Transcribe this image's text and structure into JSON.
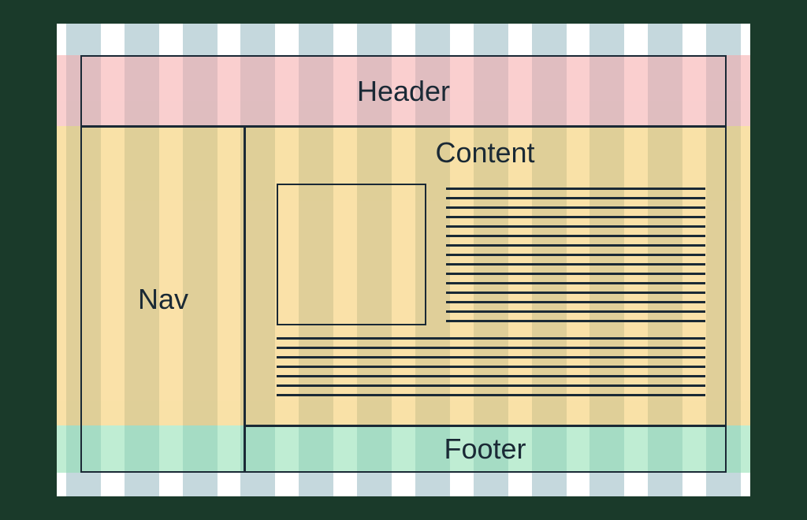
{
  "diagram": {
    "type": "layout-wireframe",
    "columns": 12,
    "regions": {
      "header": {
        "label": "Header"
      },
      "nav": {
        "label": "Nav"
      },
      "content": {
        "label": "Content"
      },
      "footer": {
        "label": "Footer"
      }
    },
    "colors": {
      "header_band": "#f5a8a8",
      "middle_band": "#f5c960",
      "footer_band": "#8be0b0",
      "column_stripe": "#c5d8dd",
      "border": "#1a2935"
    }
  }
}
